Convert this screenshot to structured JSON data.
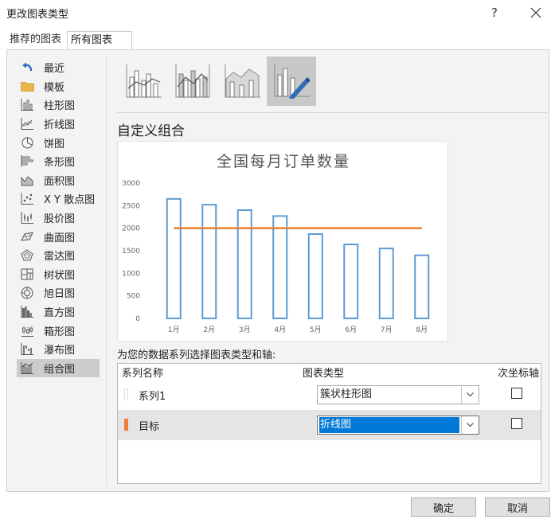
{
  "window": {
    "title": "更改图表类型",
    "help": "?"
  },
  "tabs": [
    {
      "label": "推荐的图表",
      "active": false
    },
    {
      "label": "所有图表",
      "active": true
    }
  ],
  "categories": [
    {
      "label": "最近",
      "icon": "recent-icon"
    },
    {
      "label": "模板",
      "icon": "folder-icon"
    },
    {
      "label": "柱形图",
      "icon": "column-chart-icon"
    },
    {
      "label": "折线图",
      "icon": "line-chart-icon"
    },
    {
      "label": "饼图",
      "icon": "pie-chart-icon"
    },
    {
      "label": "条形图",
      "icon": "bar-chart-icon"
    },
    {
      "label": "面积图",
      "icon": "area-chart-icon"
    },
    {
      "label": "X Y 散点图",
      "icon": "scatter-chart-icon"
    },
    {
      "label": "股价图",
      "icon": "stock-chart-icon"
    },
    {
      "label": "曲面图",
      "icon": "surface-chart-icon"
    },
    {
      "label": "雷达图",
      "icon": "radar-chart-icon"
    },
    {
      "label": "树状图",
      "icon": "treemap-chart-icon"
    },
    {
      "label": "旭日图",
      "icon": "sunburst-chart-icon"
    },
    {
      "label": "直方图",
      "icon": "histogram-chart-icon"
    },
    {
      "label": "箱形图",
      "icon": "box-whisker-chart-icon"
    },
    {
      "label": "瀑布图",
      "icon": "waterfall-chart-icon"
    },
    {
      "label": "组合图",
      "icon": "combo-chart-icon",
      "selected": true
    }
  ],
  "subtypes": [
    {
      "icon": "clustered-column-line-icon",
      "selected": false
    },
    {
      "icon": "clustered-column-line-secondary-axis-icon",
      "selected": false
    },
    {
      "icon": "stacked-area-clustered-column-icon",
      "selected": false
    },
    {
      "icon": "custom-combination-icon",
      "selected": true
    }
  ],
  "section_title": "自定义组合",
  "chart_data": {
    "type": "bar",
    "title": "全国每月订单数量",
    "categories": [
      "1月",
      "2月",
      "3月",
      "4月",
      "5月",
      "6月",
      "7月",
      "8月"
    ],
    "series": [
      {
        "name": "系列1",
        "chart": "bar",
        "values": [
          2650,
          2520,
          2400,
          2270,
          1870,
          1640,
          1550,
          1400
        ],
        "color": "#5b9bd5"
      },
      {
        "name": "目标",
        "chart": "line",
        "values": [
          2000,
          2000,
          2000,
          2000,
          2000,
          2000,
          2000,
          2000
        ],
        "color": "#ed7d31"
      }
    ],
    "yticks": [
      0,
      500,
      1000,
      1500,
      2000,
      2500,
      3000
    ],
    "ylim": [
      0,
      3000
    ],
    "grid": false,
    "legend": "none"
  },
  "series_prompt": "为您的数据系列选择图表类型和轴:",
  "grid": {
    "headers": {
      "name": "系列名称",
      "type": "图表类型",
      "secondary": "次坐标轴"
    },
    "rows": [
      {
        "name": "系列1",
        "type": "簇状柱形图",
        "secondary": false,
        "color": "#ffffff",
        "selected": false
      },
      {
        "name": "目标",
        "type": "折线图",
        "secondary": false,
        "color": "#ed7d31",
        "selected": true
      }
    ]
  },
  "buttons": {
    "ok": "确定",
    "cancel": "取消"
  }
}
